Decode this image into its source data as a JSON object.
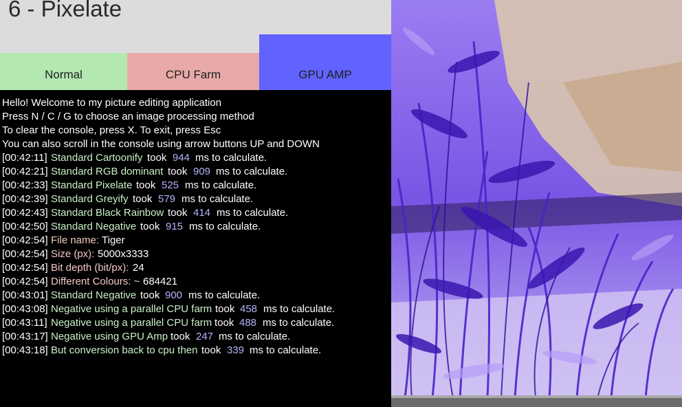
{
  "app": {
    "title": "6 - Pixelate"
  },
  "tabs": [
    {
      "label": "Normal",
      "color": "#b3e8b0"
    },
    {
      "label": "CPU Farm",
      "color": "#e8aaa8"
    },
    {
      "label": "GPU AMP",
      "color": "#6262ff",
      "selected": true
    }
  ],
  "console": {
    "intro": [
      "Hello! Welcome to my picture editing application",
      "Press N / C / G to choose an image processing method",
      "To clear the console, press X. To exit, press Esc",
      "You can also scroll in the console using arrow buttons UP and DOWN"
    ],
    "log": [
      {
        "ts": "[00:42:11]",
        "text": "Standard Cartoonify",
        "took": "took",
        "num": "944",
        "tail": "ms to calculate."
      },
      {
        "ts": "[00:42:21]",
        "text": "Standard RGB dominant",
        "took": "took",
        "num": "909",
        "tail": "ms to calculate."
      },
      {
        "ts": "[00:42:33]",
        "text": "Standard Pixelate",
        "took": "took",
        "num": "525",
        "tail": "ms to calculate."
      },
      {
        "ts": "[00:42:39]",
        "text": "Standard Greyify",
        "took": "took",
        "num": "579",
        "tail": "ms to calculate."
      },
      {
        "ts": "[00:42:43]",
        "text": "Standard Black Rainbow",
        "took": "took",
        "num": "414",
        "tail": "ms to calculate."
      },
      {
        "ts": "[00:42:50]",
        "text": "Standard Negative",
        "took": "took",
        "num": "915",
        "tail": "ms to calculate."
      },
      {
        "ts": "[00:42:54]",
        "key": "File name:",
        "value": "Tiger"
      },
      {
        "ts": "[00:42:54]",
        "key": "Size (px):",
        "value": "5000x3333"
      },
      {
        "ts": "[00:42:54]",
        "key": "Bit depth (bit/px):",
        "value": "24"
      },
      {
        "ts": "[00:42:54]",
        "key": "Different Colours: ~",
        "value": "684421"
      },
      {
        "ts": "[00:43:01]",
        "text": "Standard Negative",
        "took": "took",
        "num": "900",
        "tail": "ms to calculate."
      },
      {
        "ts": "[00:43:08]",
        "text": "Negative using a parallel CPU farm",
        "took": "took",
        "num": "458",
        "tail": "ms to calculate."
      },
      {
        "ts": "[00:43:11]",
        "text": "Negative using a parallel CPU farm",
        "took": "took",
        "num": "488",
        "tail": "ms to calculate."
      },
      {
        "ts": "[00:43:17]",
        "text": "Negative using GPU Amp",
        "took": "took",
        "num": "247",
        "tail": "ms to calculate."
      },
      {
        "ts": "[00:43:18]",
        "text": "But conversion back to cpu then",
        "took": "took",
        "num": "339",
        "tail": "ms to calculate."
      }
    ]
  }
}
